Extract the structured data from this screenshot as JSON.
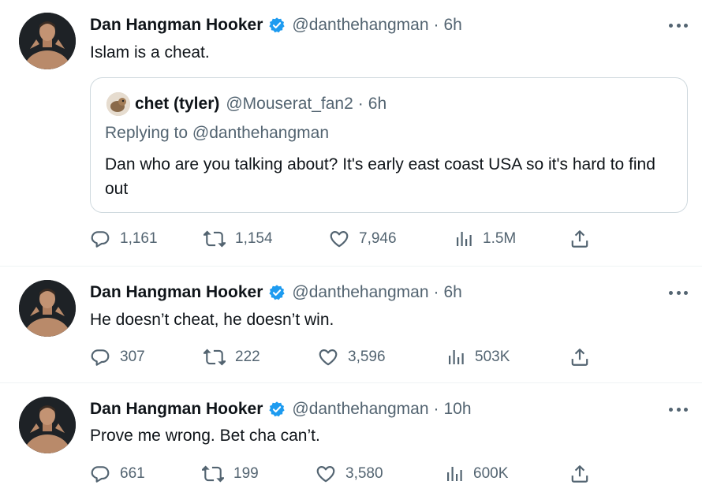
{
  "tweets": [
    {
      "name": "Dan Hangman Hooker",
      "handle": "@danthehangman",
      "time": "6h",
      "text": "Islam is a cheat.",
      "quote": {
        "name": "chet (tyler)",
        "handle": "@Mouserat_fan2",
        "time": "6h",
        "replying": "Replying to @danthehangman",
        "text": "Dan who are you talking about? It's early east coast USA so it's hard to find out"
      },
      "replies": "1,161",
      "retweets": "1,154",
      "likes": "7,946",
      "views": "1.5M"
    },
    {
      "name": "Dan Hangman Hooker",
      "handle": "@danthehangman",
      "time": "6h",
      "text": "He doesn’t cheat, he doesn’t win.",
      "replies": "307",
      "retweets": "222",
      "likes": "3,596",
      "views": "503K"
    },
    {
      "name": "Dan Hangman Hooker",
      "handle": "@danthehangman",
      "time": "10h",
      "text": "Prove me wrong. Bet cha can’t.",
      "replies": "661",
      "retweets": "199",
      "likes": "3,580",
      "views": "600K"
    }
  ],
  "colors": {
    "verified": "#1d9bf0",
    "secondary_text": "#536471",
    "divider": "#eff3f4"
  },
  "icons": [
    "verified-badge-icon",
    "more-icon",
    "reply-icon",
    "retweet-icon",
    "like-icon",
    "views-icon",
    "share-icon"
  ]
}
